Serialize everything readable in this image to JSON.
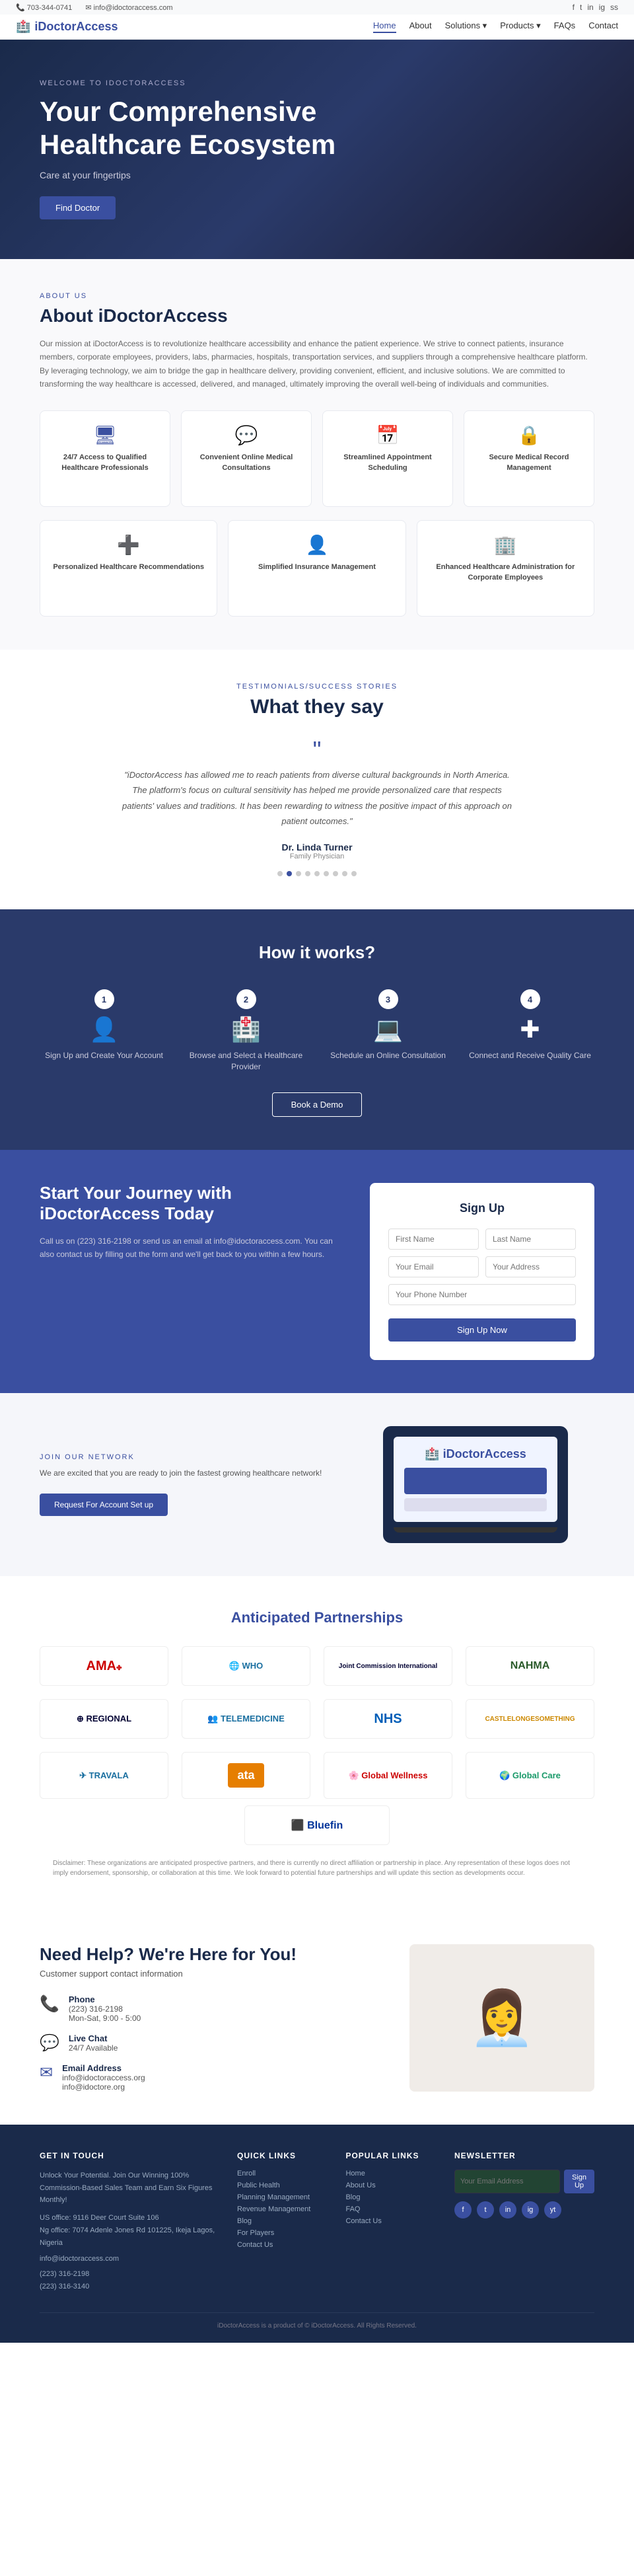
{
  "topbar": {
    "phone": "📞 703-344-0741",
    "email": "✉ info@idoctoraccess.com",
    "social": [
      "f",
      "t",
      "in",
      "ig",
      "ss"
    ]
  },
  "navbar": {
    "logo": "iDoctorAccess",
    "logo_icon": "🏥",
    "links": [
      "Home",
      "About",
      "Solutions",
      "Products",
      "FAQs",
      "Contact"
    ],
    "active": "Home"
  },
  "hero": {
    "welcome": "WELCOME TO IDOCTORACCESS",
    "headline1": "Your Comprehensive",
    "headline2": "Healthcare Ecosystem",
    "tagline": "Care at your fingertips",
    "cta": "Find Doctor"
  },
  "about": {
    "subtitle": "ABOUT US",
    "title": "About iDoctorAccess",
    "description": "Our mission at iDoctorAccess is to revolutionize healthcare accessibility and enhance the patient experience. We strive to connect patients, insurance members, corporate employees, providers, labs, pharmacies, hospitals, transportation services, and suppliers through a comprehensive healthcare platform. By leveraging technology, we aim to bridge the gap in healthcare delivery, providing convenient, efficient, and inclusive solutions. We are committed to transforming the way healthcare is accessed, delivered, and managed, ultimately improving the overall well-being of individuals and communities.",
    "features": [
      {
        "icon": "🖥",
        "label": "24/7 Access to Qualified Healthcare Professionals"
      },
      {
        "icon": "💬",
        "label": "Convenient Online Medical Consultations"
      },
      {
        "icon": "📅",
        "label": "Streamlined Appointment Scheduling"
      },
      {
        "icon": "🔒",
        "label": "Secure Medical Record Management"
      }
    ],
    "features2": [
      {
        "icon": "➕",
        "label": "Personalized Healthcare Recommendations"
      },
      {
        "icon": "👤",
        "label": "Simplified Insurance Management"
      },
      {
        "icon": "🏢",
        "label": "Enhanced Healthcare Administration for Corporate Employees"
      }
    ]
  },
  "testimonials": {
    "subtitle": "TESTIMONIALS/SUCCESS STORIES",
    "title": "What they say",
    "quote": "\"iDoctorAccess has allowed me to reach patients from diverse cultural backgrounds in North America. The platform's focus on cultural sensitivity has helped me provide personalized care that respects patients' values and traditions. It has been rewarding to witness the positive impact of this approach on patient outcomes.\"",
    "name": "Dr. Linda Turner",
    "role": "Family Physician",
    "dots": 9
  },
  "how_it_works": {
    "title": "How it works?",
    "steps": [
      {
        "num": "1",
        "icon": "👤",
        "label": "Sign Up and Create Your Account"
      },
      {
        "num": "2",
        "icon": "🏥",
        "label": "Browse and Select a Healthcare Provider"
      },
      {
        "num": "3",
        "icon": "💻",
        "label": "Schedule an Online Consultation"
      },
      {
        "num": "4",
        "icon": "✚",
        "label": "Connect and Receive Quality Care"
      }
    ],
    "cta": "Book a Demo"
  },
  "signup": {
    "headline1": "Start Your Journey with",
    "headline2": "iDoctorAccess Today",
    "description": "Call us on (223) 316-2198 or send us an email at info@idoctoraccess.com. You can also contact us by filling out the form and we'll get back to you within a few hours.",
    "form": {
      "title": "Sign Up",
      "first_name_placeholder": "First Name",
      "last_name_placeholder": "Last Name",
      "email_placeholder": "Your Email",
      "address_placeholder": "Your Address",
      "phone_placeholder": "Your Phone Number",
      "submit": "Sign Up Now"
    }
  },
  "provider": {
    "subtitle": "JOIN OUR NETWORK",
    "title": "We are excited that you are ready to join the fastest growing healthcare network!",
    "cta": "Request For Account Set up"
  },
  "partnerships": {
    "title": "Anticipated Partnerships",
    "partners": [
      {
        "name": "AMA",
        "color": "#c00"
      },
      {
        "name": "WHO",
        "color": "#1a6fa0"
      },
      {
        "name": "Joint Commission International",
        "color": "#003"
      },
      {
        "name": "NAHMA",
        "color": "#2a5a2a"
      },
      {
        "name": "REGIONAL",
        "color": "#003"
      },
      {
        "name": "TELEMEDICINE",
        "color": "#1a6fa0"
      },
      {
        "name": "NHS",
        "color": "#005eb8"
      },
      {
        "name": "CASTLELONGSOMETHING",
        "color": "#c80"
      },
      {
        "name": "TRAVALA",
        "color": "#1a6fa0"
      },
      {
        "name": "ATA",
        "color": "#e67e00"
      },
      {
        "name": "GLOBAL WELLNESS",
        "color": "#c00"
      },
      {
        "name": "GLOBAL CARE",
        "color": "#1a9a6a"
      },
      {
        "name": "Bluefin",
        "color": "#003399"
      }
    ],
    "disclaimer": "Disclaimer: These organizations are anticipated prospective partners, and there is currently no direct affiliation or partnership in place. Any representation of these logos does not imply endorsement, sponsorship, or collaboration at this time. We look forward to potential future partnerships and will update this section as developments occur."
  },
  "help": {
    "title": "Need Help? We're Here for You!",
    "subtitle": "Customer support contact information",
    "phone": {
      "label": "Phone",
      "value1": "(223) 316-2198",
      "value2": "Mon-Sat, 9:00 - 5:00"
    },
    "chat": {
      "label": "Live Chat",
      "value": "24/7 Available"
    },
    "email": {
      "label": "Email Address",
      "value1": "info@idoctoraccess.org",
      "value2": "info@idoctore.org"
    }
  },
  "footer": {
    "get_in_touch_title": "GET IN TOUCH",
    "get_in_touch": {
      "tagline": "Unlock Your Potential. Join Our Winning 100% Commission-Based Sales Team and Earn Six Figures Monthly!",
      "address1": "US office: 9116 Deer Court Suite 106",
      "address2": "Ng office: 7074 Adenle Jones Rd 101225, Ikeja Lagos, Nigeria",
      "email": "info@idoctoraccess.com",
      "phones": [
        "(223) 316-2198",
        "(223) 316-3140"
      ]
    },
    "quick_links_title": "QUICK LINKS",
    "quick_links": [
      "Enroll",
      "Public Health",
      "Planning Management",
      "Revenue Management",
      "Blog",
      "For Players",
      "Contact Us"
    ],
    "popular_links_title": "POPULAR LINKS",
    "popular_links": [
      "Home",
      "About Us",
      "Blog",
      "FAQ",
      "Contact Us"
    ],
    "newsletter_title": "NEWSLETTER",
    "newsletter_placeholder": "Your Email Address",
    "newsletter_btn": "Sign Up",
    "social_icons": [
      "f",
      "t",
      "in",
      "ig",
      "yt"
    ],
    "bottom": "iDoctorAccess is a product of © iDoctorAccess. All Rights Reserved."
  }
}
